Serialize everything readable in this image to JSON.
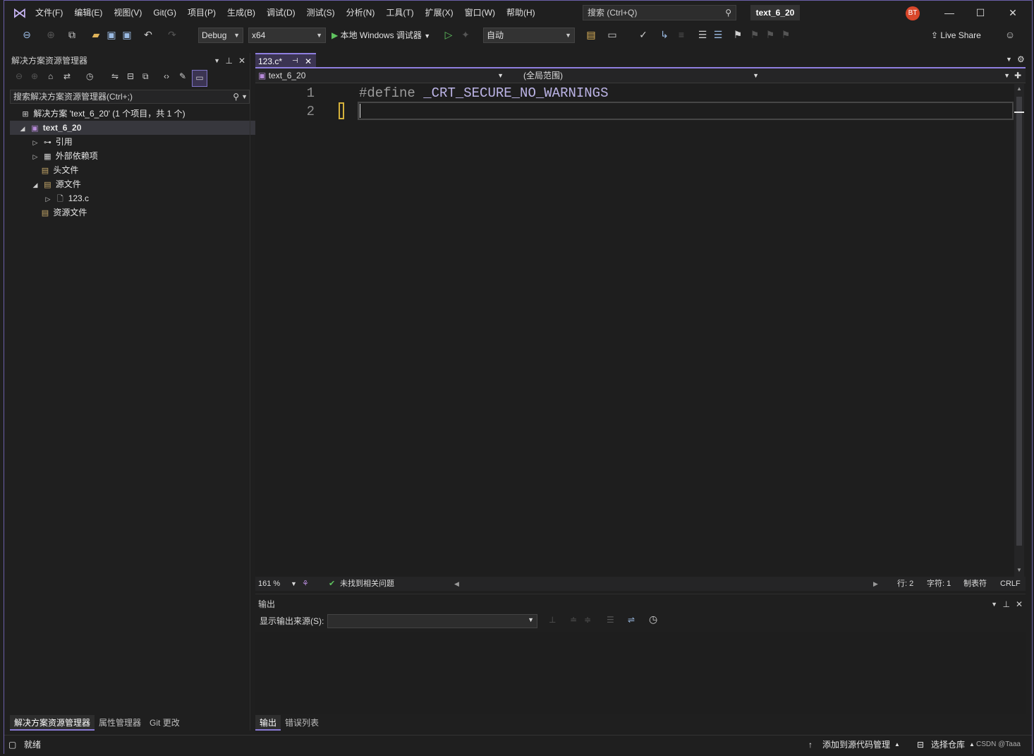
{
  "menu": [
    "文件(F)",
    "编辑(E)",
    "视图(V)",
    "Git(G)",
    "项目(P)",
    "生成(B)",
    "调试(D)",
    "测试(S)",
    "分析(N)",
    "工具(T)",
    "扩展(X)",
    "窗口(W)",
    "帮助(H)"
  ],
  "search": {
    "label": "搜索 (Ctrl+Q)"
  },
  "project_title": "text_6_20",
  "avatar_initials": "BT",
  "toolbar": {
    "config": "Debug",
    "platform": "x64",
    "run_label": "本地 Windows 调试器",
    "auto": "自动",
    "live_share": "Live Share"
  },
  "solution_explorer": {
    "title": "解决方案资源管理器",
    "search_placeholder": "搜索解决方案资源管理器(Ctrl+;)",
    "solution": "解决方案 'text_6_20' (1 个项目，共 1 个)",
    "project": "text_6_20",
    "items": [
      "引用",
      "外部依赖项",
      "头文件",
      "源文件",
      "123.c",
      "资源文件"
    ]
  },
  "left_tabs": [
    "解决方案资源管理器",
    "属性管理器",
    "Git 更改"
  ],
  "editor": {
    "tab": "123.c*",
    "nav_project": "text_6_20",
    "nav_scope": "(全局范围)",
    "lines": [
      {
        "num": "1",
        "directive": "#define",
        "macro": "_CRT_SECURE_NO_WARNINGS"
      },
      {
        "num": "2",
        "directive": "",
        "macro": ""
      }
    ],
    "zoom": "161 %",
    "issues": "未找到相关问题",
    "row": "行: 2",
    "col": "字符: 1",
    "tabs": "制表符",
    "eol": "CRLF"
  },
  "output": {
    "title": "输出",
    "source_label": "显示输出来源(S):"
  },
  "output_tabs": [
    "输出",
    "错误列表"
  ],
  "status": {
    "ready": "就绪",
    "add_scm": "添加到源代码管理",
    "select_repo": "选择仓库",
    "watermark": "CSDN @Taaa"
  },
  "colors": {
    "accent": "#8f7fe0",
    "background": "#1e1e1e",
    "avatar": "#d9472b"
  }
}
